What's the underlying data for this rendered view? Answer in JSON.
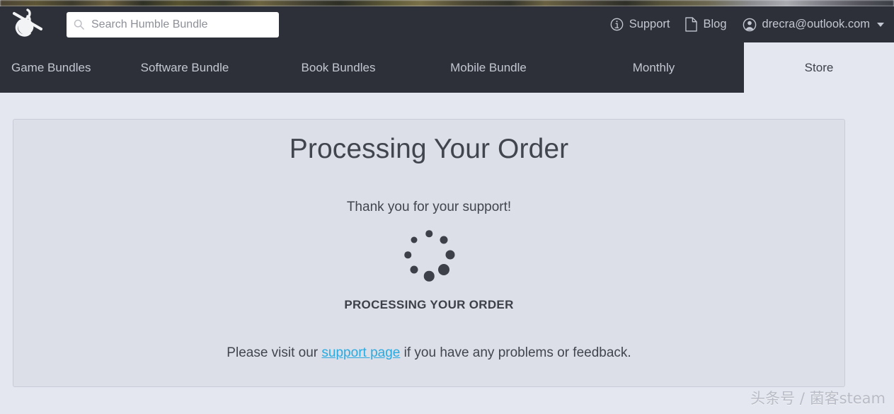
{
  "header": {
    "logo_name": "humble-bundle-logo",
    "search": {
      "placeholder": "Search Humble Bundle",
      "value": ""
    },
    "right_items": [
      {
        "label": "Support",
        "icon": "info-circle-icon"
      },
      {
        "label": "Blog",
        "icon": "document-icon"
      },
      {
        "label": "drecra@outlook.com",
        "icon": "user-circle-icon",
        "caret": "chevron-down-icon"
      }
    ]
  },
  "nav": {
    "tabs": [
      {
        "label": "Game Bundles",
        "active": false
      },
      {
        "label": "Software Bundle",
        "active": false
      },
      {
        "label": "Book Bundles",
        "active": false
      },
      {
        "label": "Mobile Bundle",
        "active": false
      },
      {
        "label": "Monthly",
        "active": false
      },
      {
        "label": "Store",
        "active": true
      }
    ]
  },
  "main": {
    "title": "Processing Your Order",
    "thanks": "Thank you for your support!",
    "status_label": "PROCESSING YOUR ORDER",
    "footer_prefix": "Please visit our ",
    "footer_link": "support page",
    "footer_suffix": " if you have any problems or feedback.",
    "spinner": {
      "name": "loading-spinner",
      "dots": 8
    }
  },
  "watermark": "头条号 / 菌客steam",
  "colors": {
    "header_bg": "#2d3038",
    "page_bg": "#e4e7ef",
    "card_bg": "#dcdfe8",
    "card_border": "#c9ccd6",
    "text_dark": "#41454d",
    "nav_text": "#c3c7d1",
    "link": "#29abe2",
    "spinner_dot": "#3d4049"
  }
}
